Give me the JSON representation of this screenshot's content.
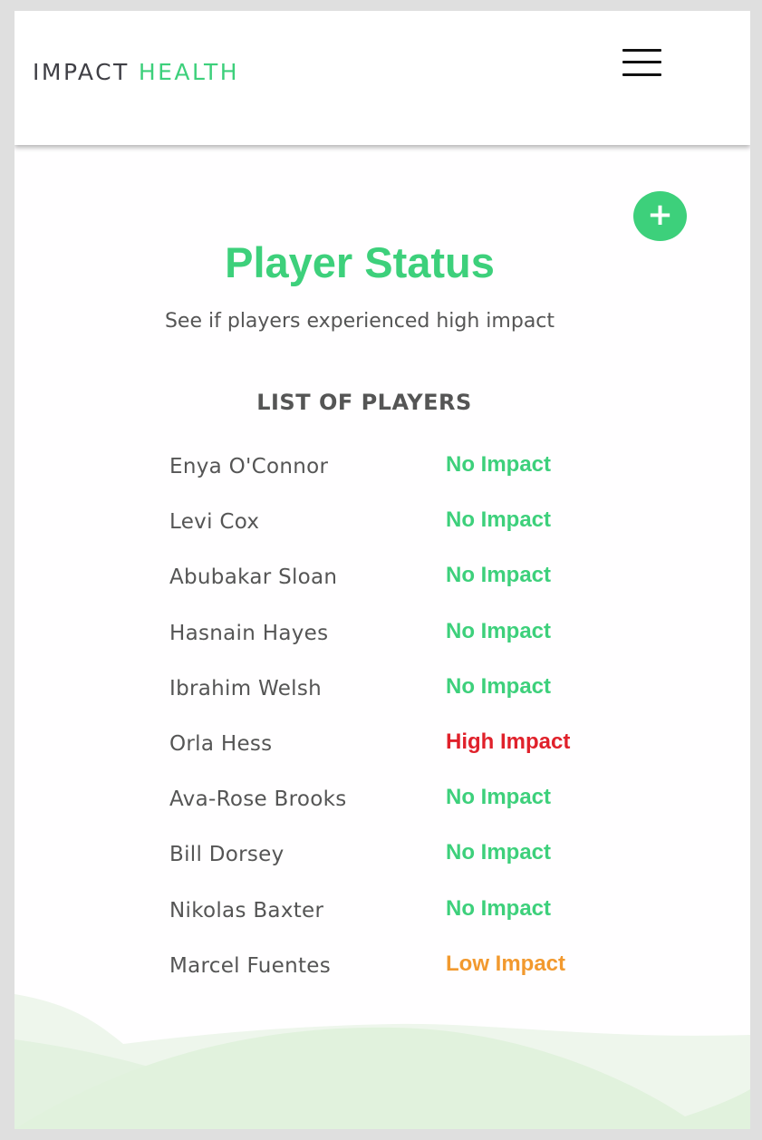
{
  "brand": {
    "word1": "IMPACT",
    "word2": "HEALTH",
    "color_dark": "#3f3f45",
    "color_accent": "#3dd07b"
  },
  "header": {
    "menu_icon": "hamburger-menu-icon"
  },
  "actions": {
    "add_icon": "plus-icon",
    "add_symbol": "+"
  },
  "page": {
    "title": "Player Status",
    "subtitle": "See if players experienced high impact",
    "list_heading": "LIST OF PLAYERS"
  },
  "status_colors": {
    "No Impact": "#3dd07b",
    "High Impact": "#e0212b",
    "Low Impact": "#f2992e"
  },
  "players": [
    {
      "name": "Enya O'Connor",
      "status": "No Impact"
    },
    {
      "name": "Levi Cox",
      "status": "No Impact"
    },
    {
      "name": "Abubakar Sloan",
      "status": "No Impact"
    },
    {
      "name": "Hasnain Hayes",
      "status": "No Impact"
    },
    {
      "name": "Ibrahim Welsh",
      "status": "No Impact"
    },
    {
      "name": "Orla Hess",
      "status": "High Impact"
    },
    {
      "name": "Ava-Rose Brooks",
      "status": "No Impact"
    },
    {
      "name": "Bill Dorsey",
      "status": "No Impact"
    },
    {
      "name": "Nikolas Baxter",
      "status": "No Impact"
    },
    {
      "name": "Marcel Fuentes",
      "status": "Low Impact"
    }
  ]
}
